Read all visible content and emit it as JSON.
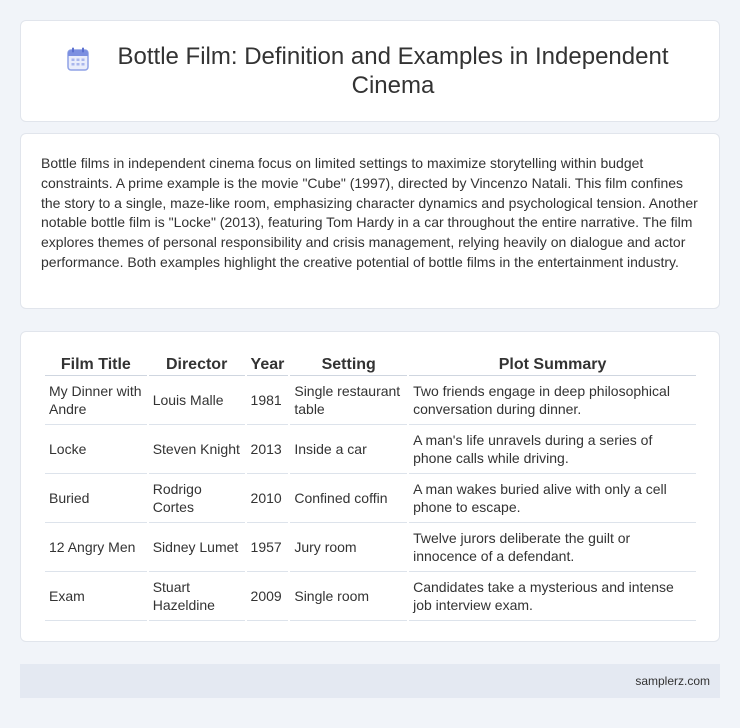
{
  "header": {
    "title": "Bottle Film: Definition and Examples in Independent Cinema",
    "icon": "calendar-icon",
    "icon_color": "#7b8fe0"
  },
  "description": "Bottle films in independent cinema focus on limited settings to maximize storytelling within budget constraints. A prime example is the movie \"Cube\" (1997), directed by Vincenzo Natali. This film confines the story to a single, maze-like room, emphasizing character dynamics and psychological tension. Another notable bottle film is \"Locke\" (2013), featuring Tom Hardy in a car throughout the entire narrative. The film explores themes of personal responsibility and crisis management, relying heavily on dialogue and actor performance. Both examples highlight the creative potential of bottle films in the entertainment industry.",
  "table": {
    "headers": [
      "Film Title",
      "Director",
      "Year",
      "Setting",
      "Plot Summary"
    ],
    "rows": [
      [
        "My Dinner with Andre",
        "Louis Malle",
        "1981",
        "Single restaurant table",
        "Two friends engage in deep philosophical conversation during dinner."
      ],
      [
        "Locke",
        "Steven Knight",
        "2013",
        "Inside a car",
        "A man's life unravels during a series of phone calls while driving."
      ],
      [
        "Buried",
        "Rodrigo Cortes",
        "2010",
        "Confined coffin",
        "A man wakes buried alive with only a cell phone to escape."
      ],
      [
        "12 Angry Men",
        "Sidney Lumet",
        "1957",
        "Jury room",
        "Twelve jurors deliberate the guilt or innocence of a defendant."
      ],
      [
        "Exam",
        "Stuart Hazeldine",
        "2009",
        "Single room",
        "Candidates take a mysterious and intense job interview exam."
      ]
    ]
  },
  "footer": {
    "text": "samplerz.com"
  }
}
